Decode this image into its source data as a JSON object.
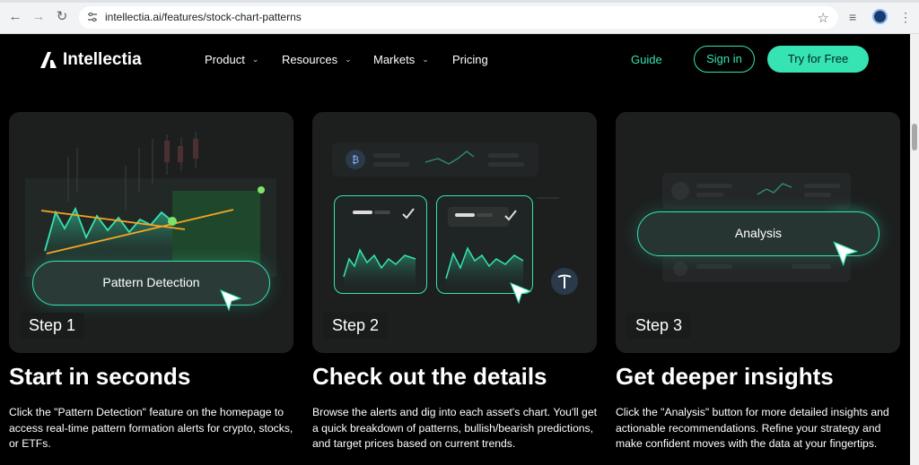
{
  "browser": {
    "url": "intellectia.ai/features/stock-chart-patterns"
  },
  "nav": {
    "brand": "Intellectia",
    "menu": [
      {
        "label": "Product",
        "has_dropdown": true
      },
      {
        "label": "Resources",
        "has_dropdown": true
      },
      {
        "label": "Markets",
        "has_dropdown": true
      },
      {
        "label": "Pricing",
        "has_dropdown": false
      }
    ],
    "guide": "Guide",
    "sign_in": "Sign in",
    "try_free": "Try for Free"
  },
  "colors": {
    "accent": "#35e3b3",
    "background": "#000000",
    "card": "#1d1f1f",
    "chart_line": "#f5a623"
  },
  "steps": [
    {
      "step": "Step 1",
      "button": "Pattern Detection",
      "heading": "Start in seconds",
      "description": "Click the \"Pattern Detection\" feature on the homepage to access real-time pattern formation alerts for crypto, stocks, or ETFs."
    },
    {
      "step": "Step 2",
      "heading": "Check out the details",
      "description": "Browse the alerts and dig into each asset's chart. You'll get a quick breakdown of patterns, bullish/bearish predictions, and target prices based on current trends.",
      "icons": [
        "bitcoin-icon",
        "tesla-icon",
        "checkmark-icon"
      ]
    },
    {
      "step": "Step 3",
      "button": "Analysis",
      "heading": "Get deeper insights",
      "description": "Click the \"Analysis\" button for more detailed insights and actionable recommendations. Refine your strategy and make confident moves with the data at your fingertips."
    }
  ]
}
